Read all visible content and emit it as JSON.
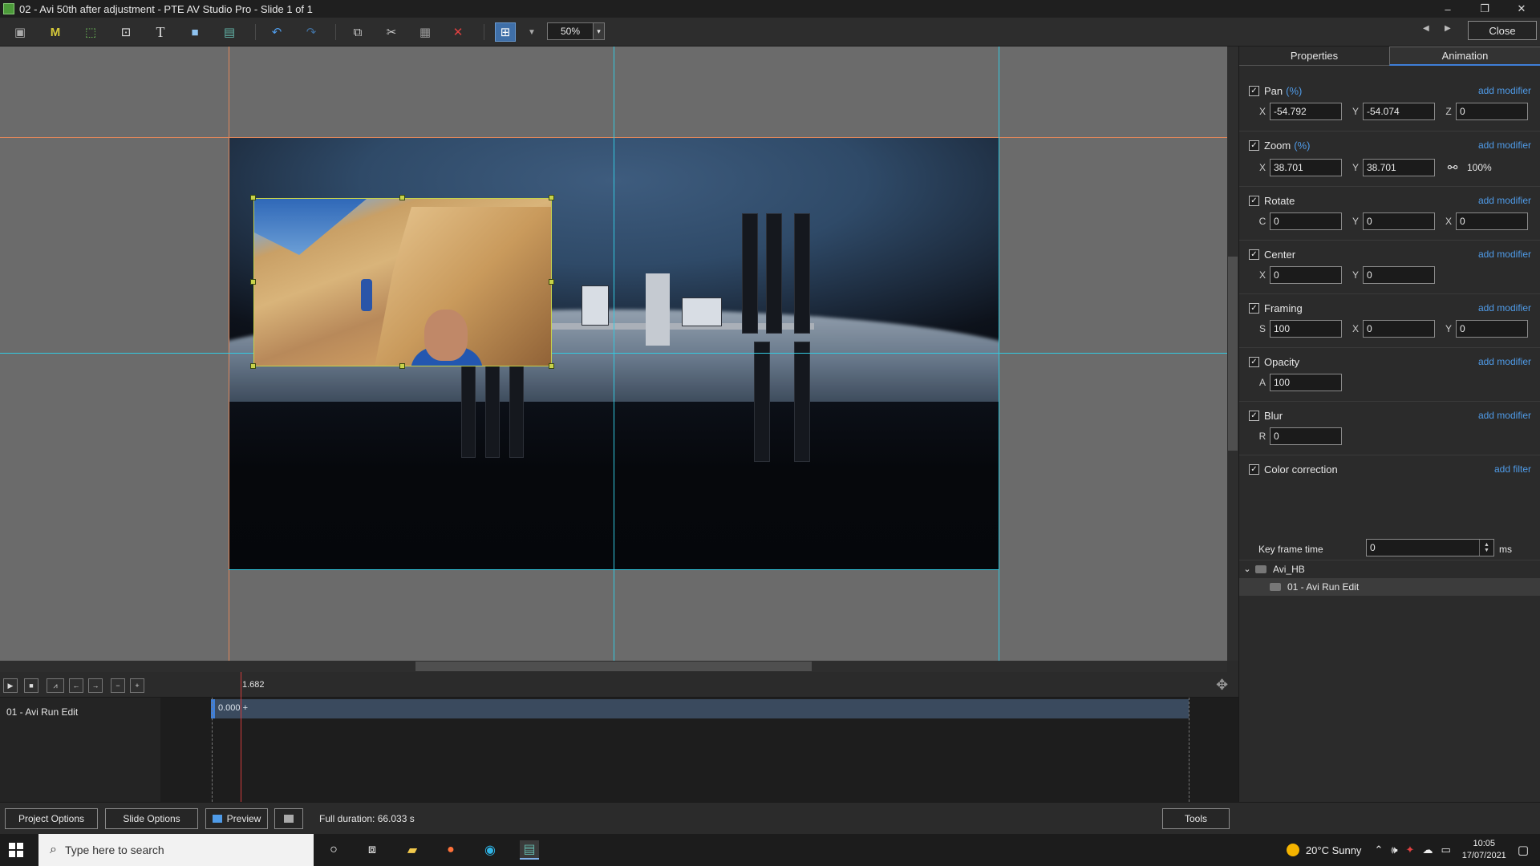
{
  "window": {
    "title": "02 - Avi 50th after adjustment  - PTE AV Studio Pro - Slide 1 of 1",
    "minimize": "–",
    "restore": "❐",
    "close": "✕"
  },
  "toolbar": {
    "zoom": "50%",
    "zoom_dropdown": "▾",
    "close_label": "Close",
    "prev": "◀",
    "next": "▶"
  },
  "tabs": [
    {
      "label": "Properties"
    },
    {
      "label": "Animation"
    }
  ],
  "animation": {
    "pan": {
      "label": "Pan",
      "unit": "(%)",
      "link": "add modifier",
      "x_label": "X",
      "x": "-54.792",
      "y_label": "Y",
      "y": "-54.074",
      "z_label": "Z",
      "z": "0"
    },
    "zoom": {
      "label": "Zoom",
      "unit": "(%)",
      "link": "add modifier",
      "x_label": "X",
      "x": "38.701",
      "y_label": "Y",
      "y": "38.701",
      "lock_icon": "⚯",
      "percent": "100%"
    },
    "rotate": {
      "label": "Rotate",
      "link": "add modifier",
      "c_label": "C",
      "c": "0",
      "y_label": "Y",
      "y": "0",
      "x_label": "X",
      "x": "0"
    },
    "center": {
      "label": "Center",
      "link": "add modifier",
      "x_label": "X",
      "x": "0",
      "y_label": "Y",
      "y": "0"
    },
    "framing": {
      "label": "Framing",
      "link": "add modifier",
      "s_label": "S",
      "s": "100",
      "x_label": "X",
      "x": "0",
      "y_label": "Y",
      "y": "0"
    },
    "opacity": {
      "label": "Opacity",
      "link": "add modifier",
      "a_label": "A",
      "a": "100"
    },
    "blur": {
      "label": "Blur",
      "link": "add modifier",
      "r_label": "R",
      "r": "0"
    },
    "color_correction": {
      "label": "Color correction",
      "link": "add filter"
    },
    "keyframe": {
      "label": "Key frame time",
      "value": "0",
      "unit": "ms"
    },
    "check": "✓"
  },
  "tree": {
    "parent": "Avi_HB",
    "child": "01 - Avi Run Edit",
    "expander": "⌄"
  },
  "timeline": {
    "time": "1.682",
    "track": "01 - Avi Run Edit",
    "keyframe_time": "0.000",
    "keyframe_plus": "+",
    "controls": [
      "▶",
      "■",
      "⩘",
      "←",
      "→",
      "−",
      "+"
    ]
  },
  "bottombar": {
    "project_options": "Project Options",
    "slide_options": "Slide Options",
    "preview": "Preview",
    "full_duration": "Full duration: 66.033 s",
    "tools": "Tools"
  },
  "taskbar": {
    "search_placeholder": "Type here to search",
    "weather": "20°C  Sunny",
    "time": "10:05",
    "date": "17/07/2021"
  },
  "colors": {
    "guide_orange": "#e0875b",
    "guide_cyan": "#33c9e0",
    "accent": "#4f9be8"
  }
}
